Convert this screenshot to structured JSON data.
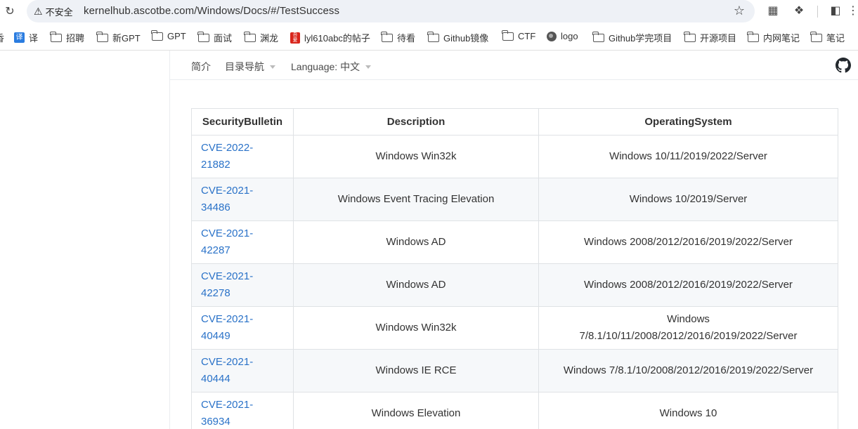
{
  "browser": {
    "security_label": "不安全",
    "url": "kernelhub.ascotbe.com/Windows/Docs/#/TestSuccess"
  },
  "bookmarks": [
    {
      "label": "译",
      "icon": "translate-icon"
    },
    {
      "label": "招聘",
      "icon": "folder-icon"
    },
    {
      "label": "新GPT",
      "icon": "folder-icon"
    },
    {
      "label": "GPT",
      "icon": "folder-icon"
    },
    {
      "label": "面试",
      "icon": "folder-icon"
    },
    {
      "label": "渊龙",
      "icon": "folder-icon"
    },
    {
      "label": "lyl610abc的帖子",
      "icon": "forum-icon"
    },
    {
      "label": "待看",
      "icon": "folder-icon"
    },
    {
      "label": "Github镜像",
      "icon": "folder-icon"
    },
    {
      "label": "CTF",
      "icon": "folder-icon"
    },
    {
      "label": "logo",
      "icon": "globe-icon"
    },
    {
      "label": "Github学完项目",
      "icon": "folder-icon"
    },
    {
      "label": "开源项目",
      "icon": "folder-icon"
    },
    {
      "label": "内网笔记",
      "icon": "folder-icon"
    },
    {
      "label": "笔记",
      "icon": "folder-icon"
    }
  ],
  "nav": {
    "intro": "简介",
    "toc": "目录导航",
    "language": "Language: 中文"
  },
  "table": {
    "headers": [
      "SecurityBulletin",
      "Description",
      "OperatingSystem"
    ],
    "rows": [
      {
        "cve_line1": "CVE-2022-",
        "cve_line2": "21882",
        "description": "Windows Win32k",
        "os_line1": "Windows 10/11/2019/2022/Server",
        "os_line2": ""
      },
      {
        "cve_line1": "CVE-2021-",
        "cve_line2": "34486",
        "description": "Windows Event Tracing Elevation",
        "os_line1": "Windows 10/2019/Server",
        "os_line2": ""
      },
      {
        "cve_line1": "CVE-2021-",
        "cve_line2": "42287",
        "description": "Windows AD",
        "os_line1": "Windows 2008/2012/2016/2019/2022/Server",
        "os_line2": ""
      },
      {
        "cve_line1": "CVE-2021-",
        "cve_line2": "42278",
        "description": "Windows AD",
        "os_line1": "Windows 2008/2012/2016/2019/2022/Server",
        "os_line2": ""
      },
      {
        "cve_line1": "CVE-2021-",
        "cve_line2": "40449",
        "description": "Windows Win32k",
        "os_line1": "Windows",
        "os_line2": "7/8.1/10/11/2008/2012/2016/2019/2022/Server"
      },
      {
        "cve_line1": "CVE-2021-",
        "cve_line2": "40444",
        "description": "Windows IE RCE",
        "os_line1": "Windows 7/8.1/10/2008/2012/2016/2019/2022/Server",
        "os_line2": ""
      },
      {
        "cve_line1": "CVE-2021-",
        "cve_line2": "36934",
        "description": "Windows Elevation",
        "os_line1": "Windows 10",
        "os_line2": ""
      }
    ]
  }
}
